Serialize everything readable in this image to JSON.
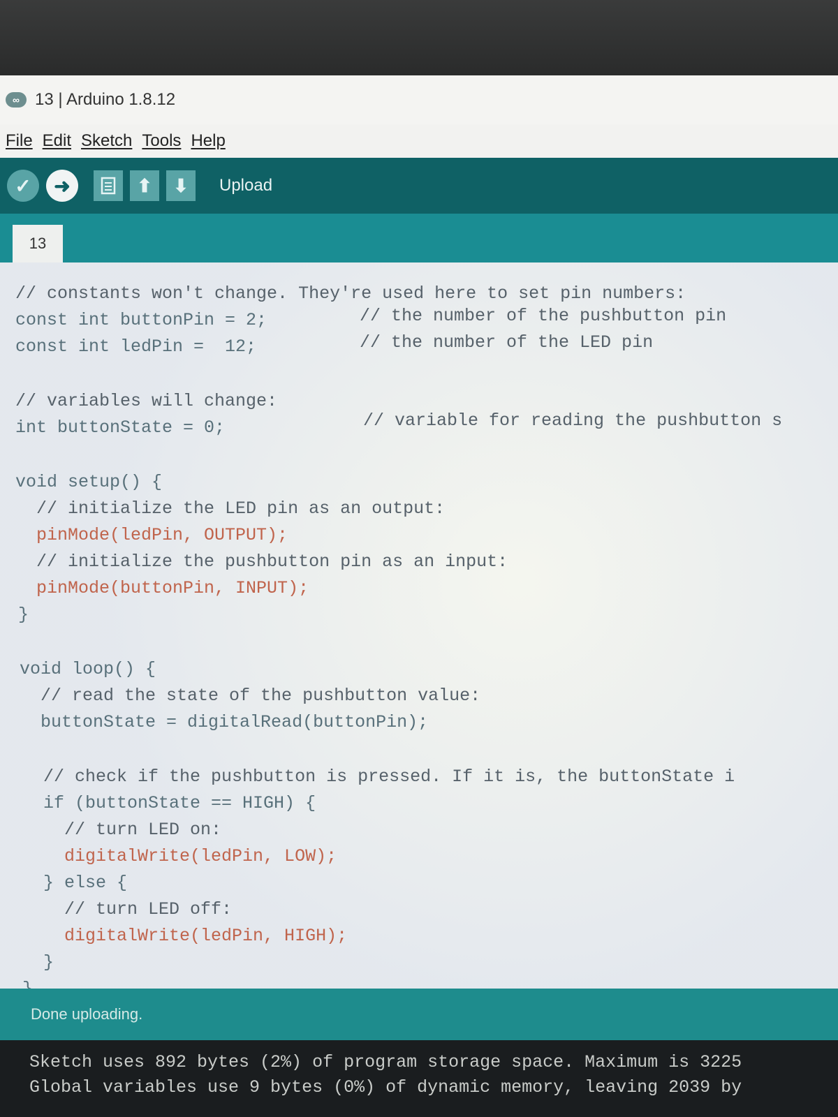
{
  "window": {
    "title": "13 | Arduino 1.8.12",
    "logo_glyph": "∞"
  },
  "menu": [
    "File",
    "Edit",
    "Sketch",
    "Tools",
    "Help"
  ],
  "toolbar": {
    "hover_label": "Upload",
    "verify_icon": "check-icon",
    "upload_icon": "arrow-right-icon",
    "new_icon": "file-icon",
    "open_icon": "arrow-up-icon",
    "save_icon": "arrow-down-icon"
  },
  "tabs": [
    {
      "label": "13"
    }
  ],
  "code": [
    {
      "text": "// constants won't change. They're used here to set pin numbers:"
    },
    {
      "text": "const int buttonPin = 2;",
      "comment": "// the number of the pushbutton pin"
    },
    {
      "text": "const int ledPin =  12;",
      "comment": "// the number of the LED pin"
    },
    {
      "text": "// variables will change:"
    },
    {
      "text": "int buttonState = 0;",
      "comment": "// variable for reading the pushbutton s"
    },
    {
      "text": "void setup() {"
    },
    {
      "text": "  // initialize the LED pin as an output:"
    },
    {
      "text": "  pinMode(ledPin, OUTPUT);"
    },
    {
      "text": "  // initialize the pushbutton pin as an input:"
    },
    {
      "text": "  pinMode(buttonPin, INPUT);"
    },
    {
      "text": "}"
    },
    {
      "text": "void loop() {"
    },
    {
      "text": "  // read the state of the pushbutton value:"
    },
    {
      "text": "  buttonState = digitalRead(buttonPin);"
    },
    {
      "text": "  // check if the pushbutton is pressed. If it is, the buttonState i"
    },
    {
      "text": "  if (buttonState == HIGH) {"
    },
    {
      "text": "    // turn LED on:"
    },
    {
      "text": "    digitalWrite(ledPin, LOW);"
    },
    {
      "text": "  } else {"
    },
    {
      "text": "    // turn LED off:"
    },
    {
      "text": "    digitalWrite(ledPin, HIGH);"
    },
    {
      "text": "  }"
    },
    {
      "text": "}"
    }
  ],
  "status": {
    "message": "Done uploading."
  },
  "console": [
    "Sketch uses 892 bytes (2%) of program storage space. Maximum is 3225",
    "Global variables use 9 bytes (0%) of dynamic memory, leaving 2039 by"
  ],
  "colors": {
    "toolbar": "#0f6165",
    "tabbar": "#1a8d93",
    "status": "#1e8c8d",
    "console": "#1a1d1f"
  }
}
